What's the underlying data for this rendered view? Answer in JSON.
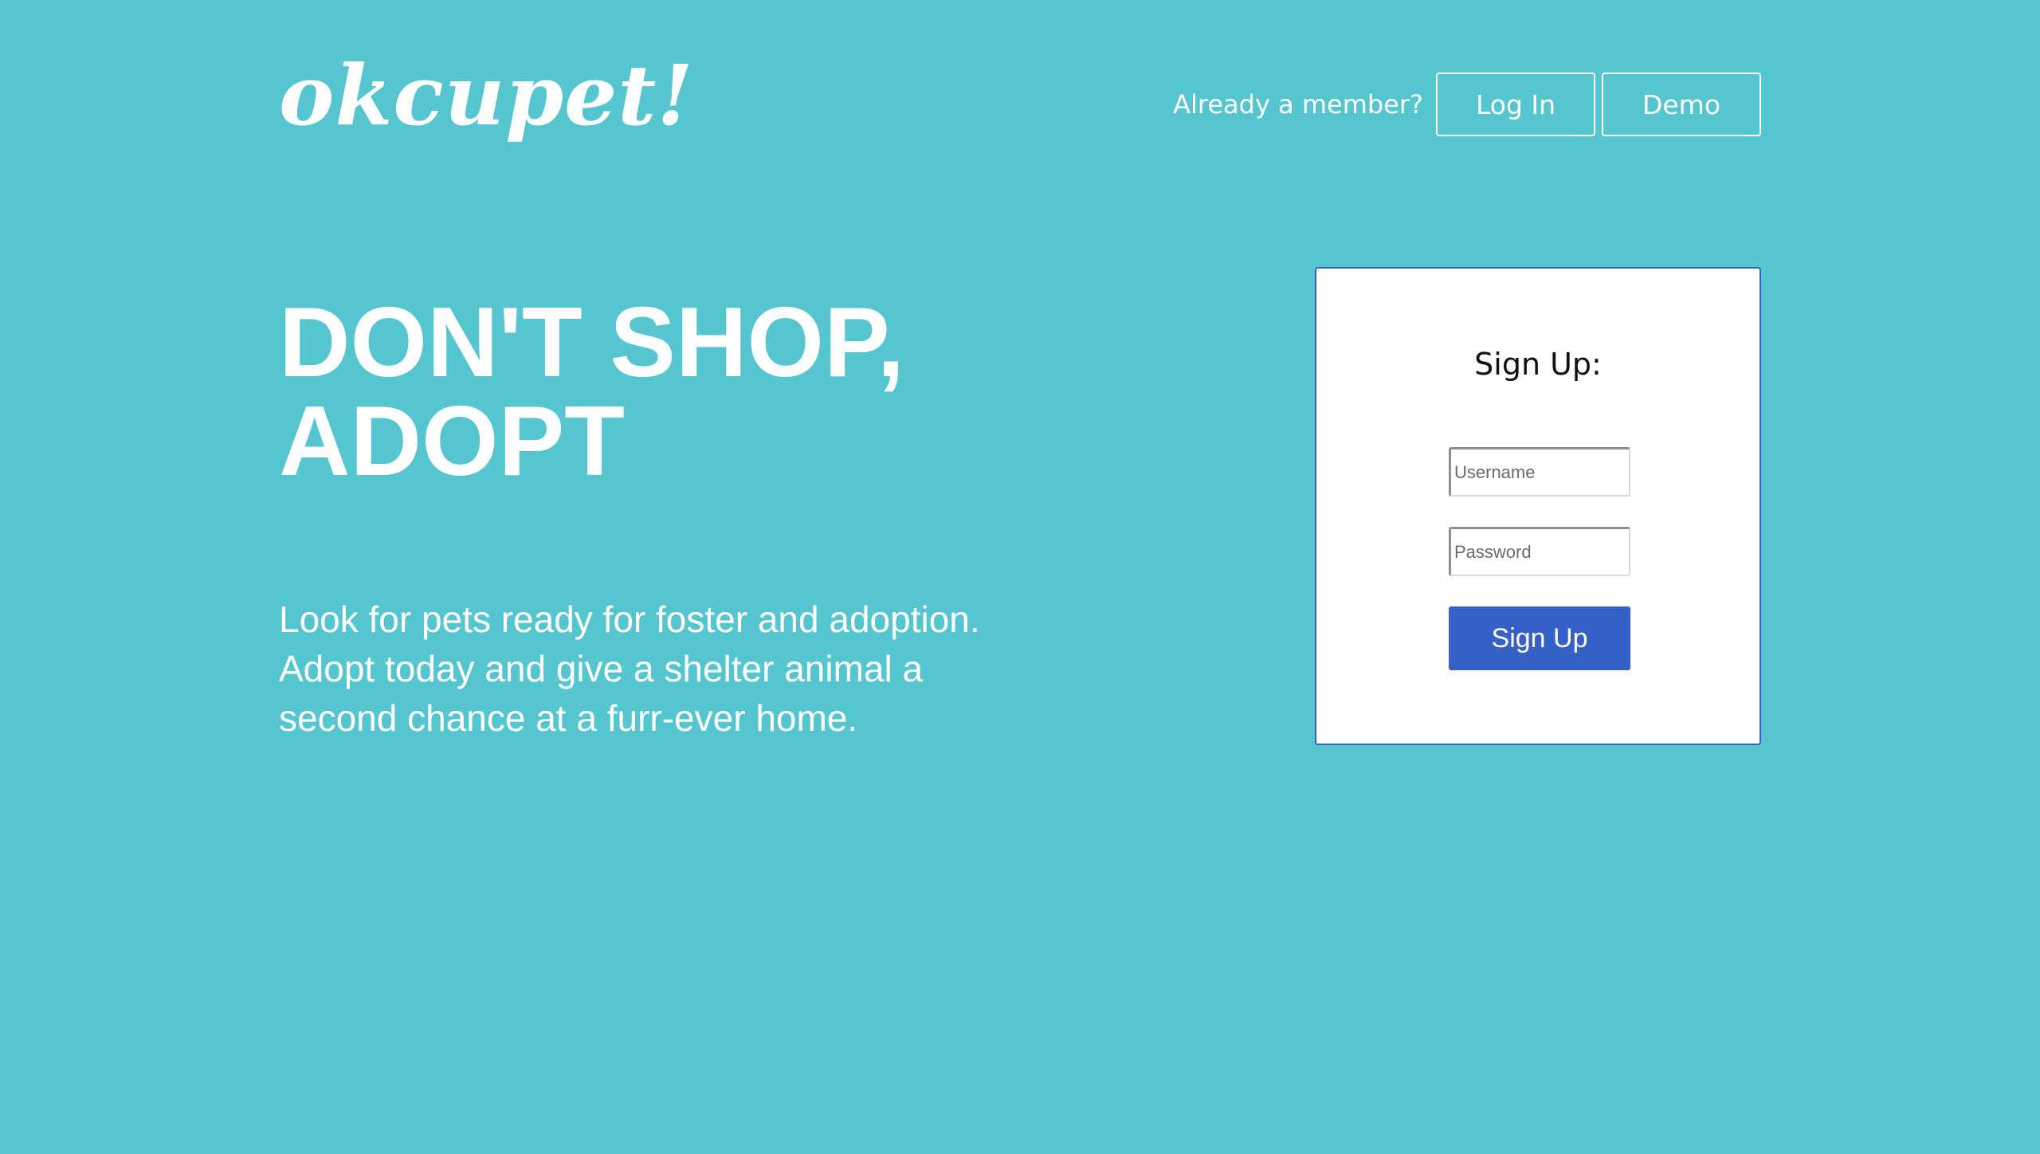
{
  "header": {
    "logo": "okcupet!",
    "member_prompt": "Already a member?",
    "login_label": "Log In",
    "demo_label": "Demo"
  },
  "hero": {
    "headline_lines": [
      "DON'T SHOP,",
      "ADOPT"
    ],
    "tagline_lines": [
      "Look for pets ready for foster and adoption.",
      "Adopt today and give a shelter animal a",
      "second chance at a furr-ever home."
    ]
  },
  "signup": {
    "title": "Sign Up:",
    "username_placeholder": "Username",
    "username_value": "",
    "password_placeholder": "Password",
    "password_value": "",
    "submit_label": "Sign Up"
  },
  "colors": {
    "background": "#55c5cf",
    "accent": "#3560c7",
    "text_light": "#ffffff",
    "card_background": "#ffffff"
  }
}
